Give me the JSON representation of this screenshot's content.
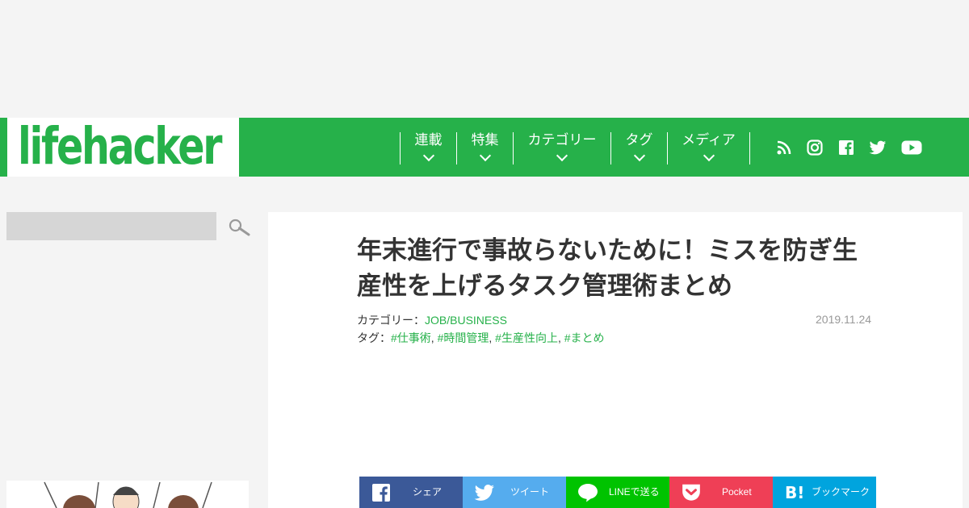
{
  "brand": {
    "logo_text": "lifehacker",
    "accent": "#26b14a"
  },
  "nav": {
    "items": [
      {
        "label": "連載"
      },
      {
        "label": "特集"
      },
      {
        "label": "カテゴリー"
      },
      {
        "label": "タグ"
      },
      {
        "label": "メディア"
      }
    ],
    "social": [
      "rss-icon",
      "instagram-icon",
      "facebook-icon",
      "twitter-icon",
      "youtube-icon"
    ]
  },
  "search": {
    "placeholder": ""
  },
  "article": {
    "title": "年末進行で事故らないために！ミスを防ぎ生産性を上げるタスク管理術まとめ",
    "category_label": "カテゴリー：",
    "category": "JOB/BUSINESS",
    "tag_label": "タグ：",
    "tags": [
      "#仕事術",
      "#時間管理",
      "#生産性向上",
      "#まとめ"
    ],
    "tag_sep": ",",
    "date": "2019.11.24"
  },
  "share": [
    {
      "label": "シェア",
      "color": "#3b5998",
      "icon": "facebook-icon"
    },
    {
      "label": "ツイート",
      "color": "#55acee",
      "icon": "twitter-icon"
    },
    {
      "label": "LINEで送る",
      "color": "#00c300",
      "icon": "line-icon"
    },
    {
      "label": "Pocket",
      "color": "#ef3f56",
      "icon": "pocket-icon"
    },
    {
      "label": "ブックマーク",
      "color": "#00a4de",
      "icon": "hatena-bookmark-icon"
    }
  ]
}
